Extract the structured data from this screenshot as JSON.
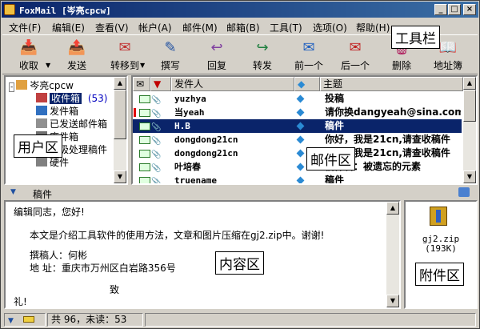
{
  "window": {
    "title": "FoxMail [岑亮cpcw]",
    "controls": [
      "_",
      "□",
      "×"
    ]
  },
  "menu": [
    "文件(F)",
    "编辑(E)",
    "查看(V)",
    "帐户(A)",
    "邮件(M)",
    "邮箱(B)",
    "工具(T)",
    "选项(O)",
    "帮助(H)"
  ],
  "toolbar": {
    "buttons": [
      {
        "label": "收取",
        "icon": "receive-icon"
      },
      {
        "label": "发送",
        "icon": "send-icon"
      },
      {
        "label": "转移到",
        "icon": "move-to-icon"
      },
      {
        "label": "撰写",
        "icon": "compose-icon"
      },
      {
        "label": "回复",
        "icon": "reply-icon"
      },
      {
        "label": "转发",
        "icon": "forward-icon"
      },
      {
        "label": "前一个",
        "icon": "previous-icon"
      },
      {
        "label": "后一个",
        "icon": "next-icon"
      },
      {
        "label": "删除",
        "icon": "delete-icon"
      },
      {
        "label": "地址簿",
        "icon": "address-book-icon"
      }
    ],
    "annotation": "工具栏"
  },
  "folders": {
    "account": "岑亮cpcw",
    "items": [
      {
        "label": "收件箱",
        "count": "(53)"
      },
      {
        "label": "发件箱",
        "count": ""
      },
      {
        "label": "已发送邮件箱",
        "count": ""
      },
      {
        "label": "废件箱",
        "count": ""
      },
      {
        "label": "垃圾处理稿件",
        "count": ""
      },
      {
        "label": "硬件",
        "count": ""
      }
    ],
    "annotation": "用户区"
  },
  "mail_list": {
    "columns": [
      "发件人",
      "主题"
    ],
    "rows": [
      {
        "sender": "yuzhya",
        "subject": "投稿",
        "selected": false,
        "flag": false
      },
      {
        "sender": "当yeah",
        "subject": "请你换dangyeah@sina.com",
        "selected": false,
        "flag": true
      },
      {
        "sender": "H.B",
        "subject": "稿件",
        "selected": true,
        "flag": false
      },
      {
        "sender": "dongdong21cn",
        "subject": "你好，我是21cn,请查收稿件",
        "selected": false,
        "flag": false
      },
      {
        "sender": "dongdong21cn",
        "subject": "你好，我是21cn,请查收稿件",
        "selected": false,
        "flag": false
      },
      {
        "sender": "叶培春",
        "subject": "稿件名：被遗忘的元素",
        "selected": false,
        "flag": false
      },
      {
        "sender": "truename",
        "subject": "稿件",
        "selected": false,
        "flag": false
      }
    ],
    "annotation": "邮件区"
  },
  "preview": {
    "header_subject": "稿件",
    "lines": [
      "编辑同志，您好!",
      "本文是介绍工具软件的使用方法，文章和图片压缩在gj2.zip中。谢谢!",
      "撰稿人：何彬",
      "地  址：重庆市万州区白岩路356号",
      "致",
      "礼!"
    ],
    "annotation": "内容区"
  },
  "attachment": {
    "filename": "gj2.zip",
    "size": "(193K)",
    "annotation": "附件区"
  },
  "status": {
    "summary": "共 96，未读：53"
  }
}
